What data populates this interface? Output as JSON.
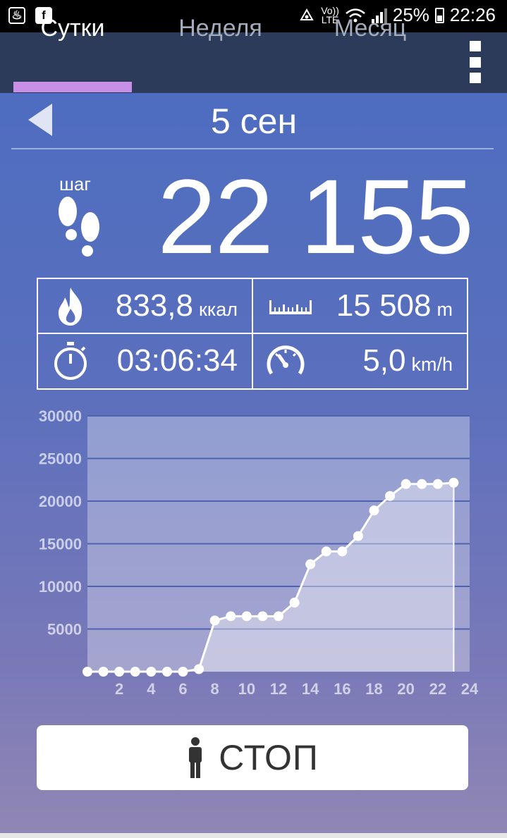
{
  "status_bar": {
    "left_icons": [
      "app-notification-icon",
      "facebook-icon"
    ],
    "network_label_top": "Vo))",
    "network_label_bottom": "LTE",
    "battery_percent": "25%",
    "time": "22:26"
  },
  "tabs": [
    {
      "label": "Сутки",
      "active": true
    },
    {
      "label": "Неделя",
      "active": false
    },
    {
      "label": "Месяц",
      "active": false
    }
  ],
  "date": "5 сен",
  "steps": {
    "label": "шаг",
    "count": "22 155"
  },
  "stats": {
    "calories": {
      "value": "833,8",
      "unit": "ккал"
    },
    "distance": {
      "value": "15 508",
      "unit": "m"
    },
    "duration": {
      "value": "03:06:34"
    },
    "speed": {
      "value": "5,0",
      "unit": "km/h"
    }
  },
  "chart_data": {
    "type": "area",
    "x": [
      0,
      1,
      2,
      3,
      4,
      5,
      6,
      7,
      8,
      9,
      10,
      11,
      12,
      13,
      14,
      15,
      16,
      17,
      18,
      19,
      20,
      21,
      22,
      23
    ],
    "values": [
      0,
      0,
      0,
      0,
      0,
      0,
      0,
      300,
      6000,
      6500,
      6500,
      6500,
      6500,
      8100,
      12600,
      14100,
      14100,
      15900,
      18900,
      20600,
      22000,
      22000,
      22000,
      22155
    ],
    "x_ticks": [
      2,
      4,
      6,
      8,
      10,
      12,
      14,
      16,
      18,
      20,
      22,
      24
    ],
    "y_ticks": [
      5000,
      10000,
      15000,
      20000,
      25000,
      30000
    ],
    "xlim": [
      0,
      24
    ],
    "ylim": [
      0,
      30000
    ],
    "grid": true,
    "title": "",
    "xlabel": "",
    "ylabel": ""
  },
  "stop_button": {
    "label": "СТОП"
  },
  "colors": {
    "tab_bar": "#2c3b59",
    "tab_indicator": "#c78fe6",
    "background_top": "#4a6cc1",
    "background_bottom": "#9187b3"
  }
}
